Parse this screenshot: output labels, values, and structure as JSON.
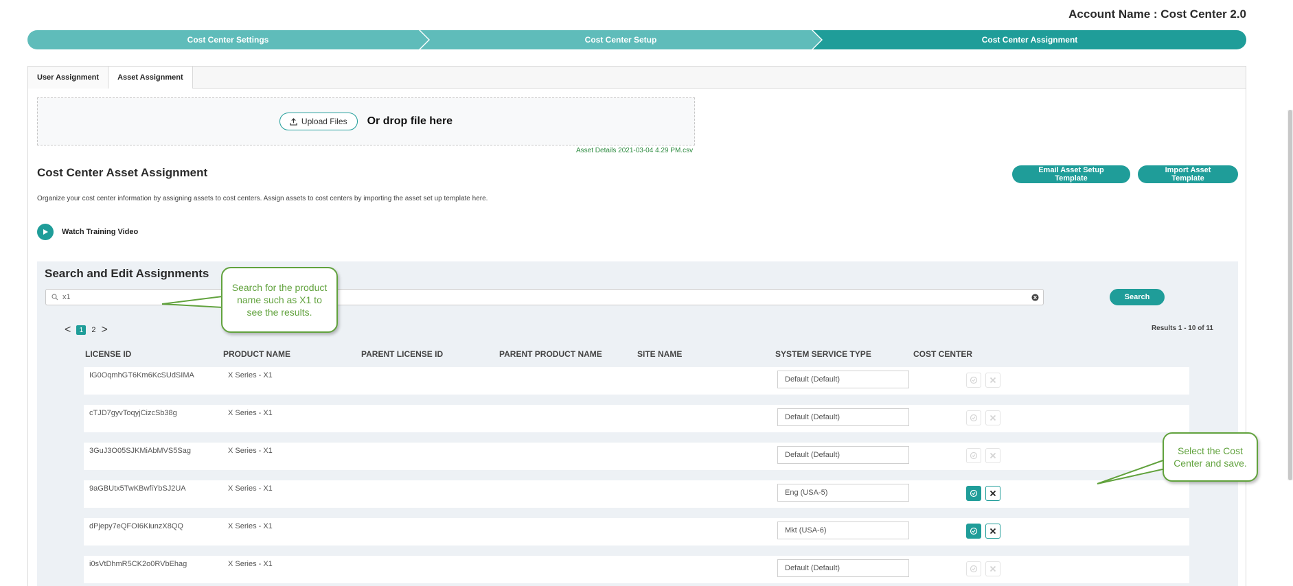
{
  "account": {
    "label": "Account Name : Cost Center 2.0"
  },
  "stepper": [
    {
      "label": "Cost Center Settings"
    },
    {
      "label": "Cost Center Setup"
    },
    {
      "label": "Cost Center Assignment"
    }
  ],
  "tabs": [
    {
      "label": "User Assignment"
    },
    {
      "label": "Asset Assignment"
    }
  ],
  "upload": {
    "button_label": "Upload Files",
    "drop_text": "Or drop file here",
    "file_name": "Asset Details 2021-03-04 4.29 PM.csv"
  },
  "section": {
    "title": "Cost Center Asset Assignment",
    "description": "Organize your cost center information by assigning assets to cost centers. Assign assets to cost centers by importing the asset set up template here.",
    "email_button": "Email Asset Setup Template",
    "import_button": "Import Asset Template",
    "video_label": "Watch Training Video"
  },
  "search": {
    "title": "Search and Edit Assignments",
    "value": "x1",
    "button_label": "Search"
  },
  "pager": {
    "prev": "<",
    "pages": [
      "1",
      "2"
    ],
    "next": ">",
    "results": "Results 1 - 10 of 11"
  },
  "table": {
    "headers": [
      "LICENSE ID",
      "PRODUCT NAME",
      "PARENT LICENSE ID",
      "PARENT PRODUCT NAME",
      "SITE NAME",
      "SYSTEM SERVICE TYPE",
      "COST CENTER"
    ],
    "rows": [
      {
        "license_id": "IG0OqmhGT6Km6KcSUdSIMA",
        "product": "X Series - X1",
        "cost_center": "Default (Default)",
        "editing": false
      },
      {
        "license_id": "cTJD7gyvToqyjCizcSb38g",
        "product": "X Series - X1",
        "cost_center": "Default (Default)",
        "editing": false
      },
      {
        "license_id": "3GuJ3O05SJKMiAbMVS5Sag",
        "product": "X Series - X1",
        "cost_center": "Default (Default)",
        "editing": false
      },
      {
        "license_id": "9aGBUtx5TwKBwfiYbSJ2UA",
        "product": "X Series - X1",
        "cost_center": "Eng (USA-5)",
        "editing": true
      },
      {
        "license_id": "dPjepy7eQFOI6KiunzX8QQ",
        "product": "X Series - X1",
        "cost_center": "Mkt (USA-6)",
        "editing": true
      },
      {
        "license_id": "i0sVtDhmR5CK2o0RVbEhag",
        "product": "X Series - X1",
        "cost_center": "Default (Default)",
        "editing": false
      }
    ]
  },
  "callouts": {
    "search_hint": "Search for the product name such as X1 to see the results.",
    "save_hint": "Select the Cost Center and save."
  },
  "colors": {
    "accent": "#1f9d99",
    "accent_light": "#5fbcba",
    "callout": "#61a23d",
    "search_bg": "#edf1f5"
  }
}
